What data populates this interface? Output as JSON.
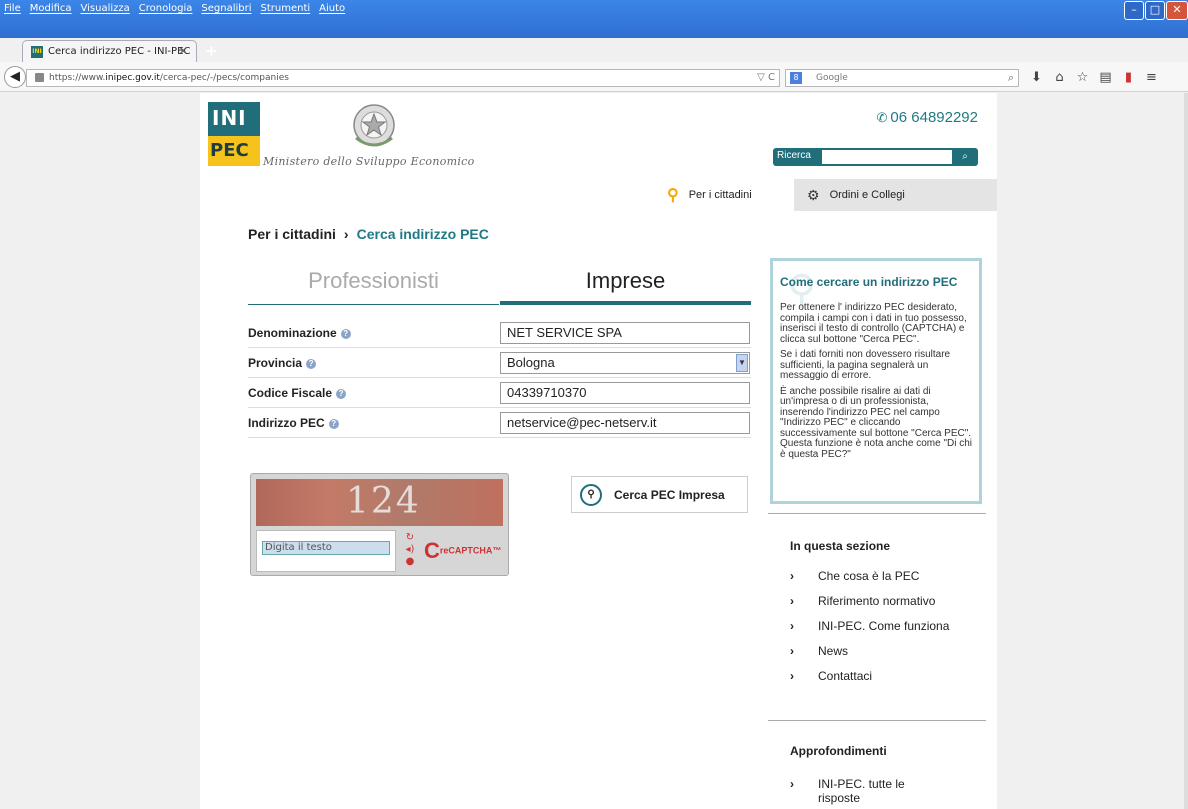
{
  "browser": {
    "menu": [
      "File",
      "Modifica",
      "Visualizza",
      "Cronologia",
      "Segnalibri",
      "Strumenti",
      "Aiuto"
    ],
    "tab_title": "Cerca indirizzo PEC - INI-PEC",
    "tab_close": "×",
    "new_tab": "+",
    "url_prefix": "https://www.",
    "url_domain": "inipec.gov.it",
    "url_path": "/cerca-pec/-/pecs/companies",
    "search_placeholder": "Google"
  },
  "header": {
    "logo_top": "INI",
    "logo_bottom": "PEC",
    "ministry": "Ministero dello Sviluppo Economico",
    "phone": "06 64892292",
    "search_label": "Ricerca"
  },
  "topnav": {
    "citizens": "Per i cittadini",
    "orders": "Ordini e Collegi"
  },
  "breadcrumb": {
    "parent": "Per i cittadini",
    "separator": "›",
    "current": "Cerca indirizzo PEC"
  },
  "tabs": {
    "professionals": "Professionisti",
    "companies": "Imprese"
  },
  "form": {
    "fields": [
      {
        "label": "Denominazione",
        "value": "NET SERVICE SPA"
      },
      {
        "label": "Provincia",
        "value": "Bologna"
      },
      {
        "label": "Codice Fiscale",
        "value": "04339710370"
      },
      {
        "label": "Indirizzo PEC",
        "value": "netservice@pec-netserv.it"
      }
    ]
  },
  "captcha": {
    "challenge": "124",
    "placeholder": "Digita il testo",
    "brand": "reCAPTCHA™"
  },
  "search_button": "Cerca PEC Impresa",
  "sidebox": {
    "title": "Come cercare un indirizzo PEC",
    "p1": "Per ottenere l' indirizzo PEC desiderato, compila i campi con i dati in tuo possesso, inserisci il testo di controllo (CAPTCHA) e clicca sul bottone \"Cerca PEC\".",
    "p2": "Se i dati forniti non dovessero risultare sufficienti, la pagina segnalerà un messaggio di errore.",
    "p3": "È anche possibile risalire ai dati di un'impresa o di un professionista, inserendo l'indirizzo PEC nel campo \"Indirizzo PEC\" e cliccando successivamente sul bottone \"Cerca PEC\". Questa funzione è nota anche come \"Di chi è questa PEC?\""
  },
  "section": {
    "title": "In questa sezione",
    "items": [
      "Che cosa è la PEC",
      "Riferimento normativo",
      "INI-PEC. Come funziona",
      "News",
      "Contattaci"
    ]
  },
  "insights": {
    "title": "Approfondimenti",
    "items": [
      "INI-PEC. tutte le risposte"
    ]
  }
}
